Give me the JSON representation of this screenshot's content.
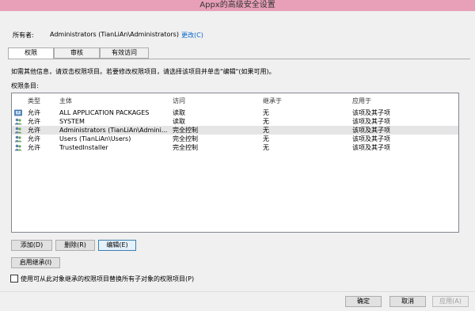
{
  "window": {
    "title": "Appx的高级安全设置"
  },
  "owner": {
    "label": "所有者:",
    "value": "Administrators (TianLiAn\\Administrators)",
    "change_link": "更改(C)"
  },
  "tabs": [
    {
      "label": "权限",
      "active": true
    },
    {
      "label": "审核",
      "active": false
    },
    {
      "label": "有效访问",
      "active": false
    }
  ],
  "hint": "如需其他信息，请双击权限项目。若要修改权限项目，请选择该项目并单击\"编辑\"(如果可用)。",
  "entries_label": "权限条目:",
  "columns": {
    "type": "类型",
    "principal": "主体",
    "access": "访问",
    "inherited": "继承于",
    "applies": "应用于"
  },
  "rows": [
    {
      "icon": "app-package-icon",
      "type": "允许",
      "principal": "ALL APPLICATION PACKAGES",
      "access": "读取",
      "inherited": "无",
      "applies": "该项及其子项"
    },
    {
      "icon": "users-icon",
      "type": "允许",
      "principal": "SYSTEM",
      "access": "读取",
      "inherited": "无",
      "applies": "该项及其子项"
    },
    {
      "icon": "users-icon",
      "type": "允许",
      "principal": "Administrators (TianLiAn\\Admini...",
      "access": "完全控制",
      "inherited": "无",
      "applies": "该项及其子项",
      "selected": true
    },
    {
      "icon": "users-icon",
      "type": "允许",
      "principal": "Users (TianLiAn\\Users)",
      "access": "完全控制",
      "inherited": "无",
      "applies": "该项及其子项"
    },
    {
      "icon": "users-icon",
      "type": "允许",
      "principal": "TrustedInstaller",
      "access": "完全控制",
      "inherited": "无",
      "applies": "该项及其子项"
    }
  ],
  "buttons": {
    "add": "添加(D)",
    "remove": "删除(R)",
    "edit": "编辑(E)",
    "enable_inheritance": "启用继承(I)",
    "ok": "确定",
    "cancel": "取消",
    "apply": "应用(A)"
  },
  "replace_checkbox": {
    "label": "使用可从此对象继承的权限项目替换所有子对象的权限项目(P)",
    "checked": false
  }
}
